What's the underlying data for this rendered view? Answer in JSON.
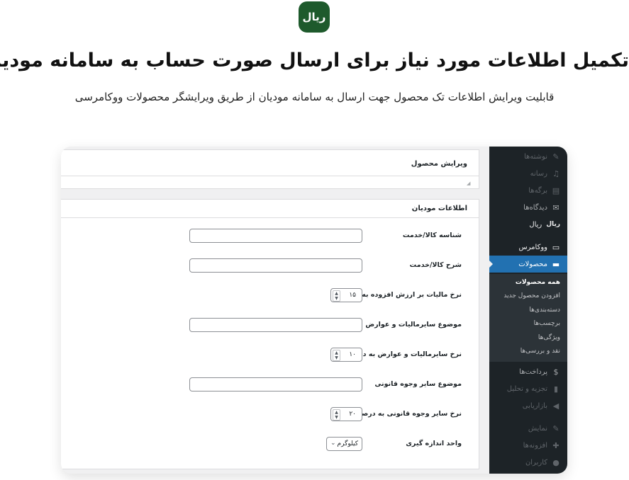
{
  "brand": {
    "logo_text": "ریال",
    "logo_color": "#1e5a2c"
  },
  "header": {
    "title": "تکمیل اطلاعات مورد نیاز برای ارسال صورت حساب به سامانه مودیان",
    "subtitle": "قابلیت ویرایش اطلاعات تک محصول جهت ارسال به سامانه مودیان از طریق ویرایشگر محصولات ووکامرسی"
  },
  "sidebar": {
    "items": [
      {
        "label": "نوشته‌ها",
        "icon": "pin-icon",
        "glyph": "✎"
      },
      {
        "label": "رسانه",
        "icon": "media-icon",
        "glyph": "♫"
      },
      {
        "label": "برگه‌ها",
        "icon": "pages-icon",
        "glyph": "▤"
      },
      {
        "label": "دیدگاه‌ها",
        "icon": "comment-icon",
        "glyph": "✉"
      },
      {
        "label": "ریال",
        "icon": "rial-icon",
        "glyph": "ریال"
      },
      {
        "label": "ووکامرس",
        "icon": "woocommerce-icon",
        "glyph": "▭"
      },
      {
        "label": "محصولات",
        "icon": "products-icon",
        "glyph": "▬"
      },
      {
        "label": "پرداخت‌ها",
        "icon": "payments-icon",
        "glyph": "$"
      },
      {
        "label": "تجزیه و تحلیل",
        "icon": "analytics-icon",
        "glyph": "▮"
      },
      {
        "label": "بازاریابی",
        "icon": "marketing-icon",
        "glyph": "◀"
      },
      {
        "label": "نمایش",
        "icon": "appearance-icon",
        "glyph": "✎"
      },
      {
        "label": "افزونه‌ها",
        "icon": "plugins-icon",
        "glyph": "✚"
      },
      {
        "label": "کاربران",
        "icon": "users-icon",
        "glyph": "●"
      }
    ],
    "submenu": [
      "همه محصولات",
      "افزودن محصول جدید",
      "دسته‌بندی‌ها",
      "برچسب‌ها",
      "ویژگی‌ها",
      "نقد و بررسی‌ها"
    ],
    "active_color": "#2271b1"
  },
  "editor": {
    "edit_title": "ویرایش محصول",
    "box_title": "اطلاعات مودیان",
    "fields": [
      {
        "label": "شناسه کالا/خدمت",
        "type": "text",
        "value": ""
      },
      {
        "label": "شرح کالا/خدمت",
        "type": "text",
        "value": ""
      },
      {
        "label": "نرخ مالیات بر ارزش افزوده به درصد",
        "type": "number",
        "value": "۱۵"
      },
      {
        "label": "موضوع سایرمالیات و عوارض",
        "type": "text",
        "value": ""
      },
      {
        "label": "نرخ سایرمالیات و عوارض به درصد",
        "type": "number",
        "value": "۱۰"
      },
      {
        "label": "موضوع سایر وجوه قانونی",
        "type": "text",
        "value": ""
      },
      {
        "label": "نرخ سایر وجوه قانونی به درصد",
        "type": "number",
        "value": "۲۰"
      },
      {
        "label": "واحد اندازه گیری",
        "type": "select",
        "value": "کیلوگرم"
      }
    ]
  }
}
